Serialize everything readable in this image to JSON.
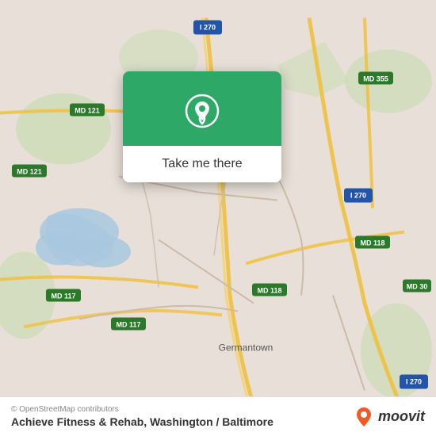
{
  "map": {
    "background_color": "#e8e0d8",
    "copyright": "© OpenStreetMap contributors",
    "location_name": "Achieve Fitness & Rehab, Washington / Baltimore"
  },
  "popup": {
    "button_label": "Take me there",
    "pin_color": "#ffffff",
    "background_color": "#2ea866"
  },
  "branding": {
    "moovit_text": "moovit"
  },
  "road_labels": [
    "I 270",
    "MD 121",
    "MD 121",
    "MD 355",
    "I 270",
    "MD 118",
    "MD 117",
    "MD 117",
    "MD 118",
    "MD 30",
    "I 270",
    "Germantown"
  ]
}
